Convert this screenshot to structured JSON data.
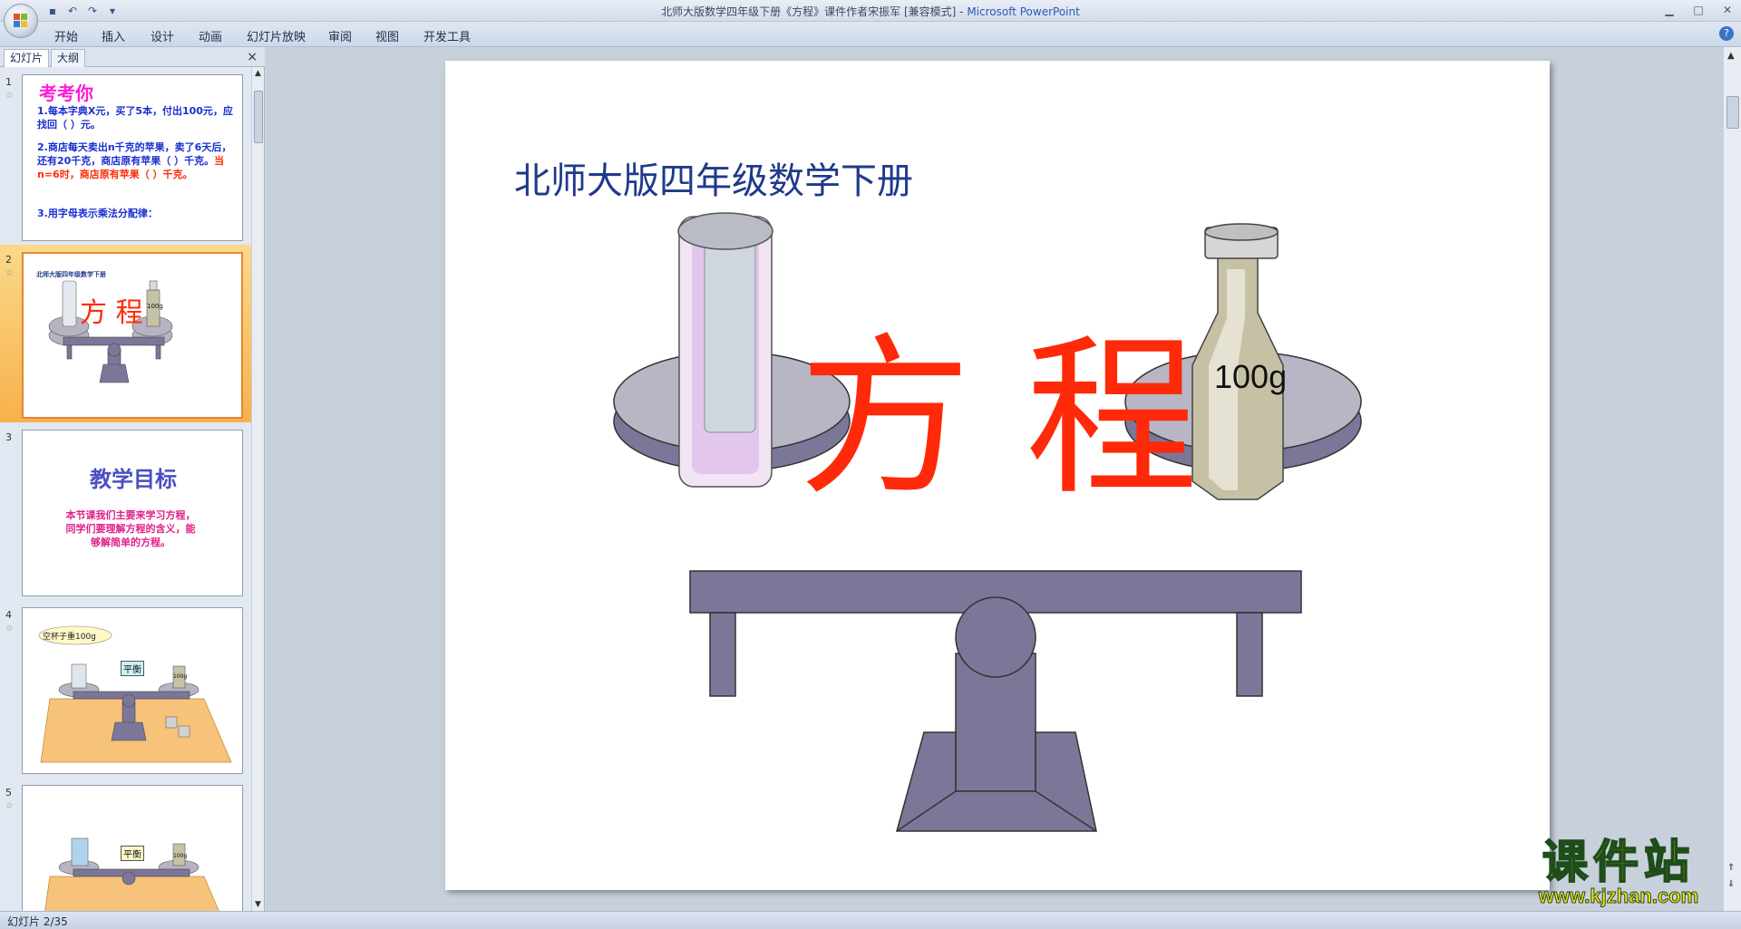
{
  "window": {
    "title": "北师大版数学四年级下册《方程》课件作者宋振军 [兼容模式]",
    "title_app": "Microsoft PowerPoint"
  },
  "ribbon": {
    "tabs": [
      "开始",
      "插入",
      "设计",
      "动画",
      "幻灯片放映",
      "审阅",
      "视图",
      "开发工具"
    ]
  },
  "pane": {
    "tabs": [
      "幻灯片",
      "大纲"
    ],
    "close_glyph": "×"
  },
  "thumbnails": [
    {
      "num": "1",
      "title": "考考你",
      "q1": "1.每本字典X元，买了5本，付出100元，应找回（    ）元。",
      "q2a": "2.商店每天卖出n千克的苹果，卖了6天后，还有20千克，商店原有苹果（    ）千克。",
      "q2b": "当n=6时，商店原有苹果（    ）千克。",
      "q3": "3.用字母表示乘法分配律："
    },
    {
      "num": "2",
      "title": "北师大版四年级数学下册",
      "word": "方 程",
      "weight": "100g"
    },
    {
      "num": "3",
      "title": "教学目标",
      "body": "本节课我们主要来学习方程，同学们要理解方程的含义，能够解简单的方程。"
    },
    {
      "num": "4",
      "bubble": "空杯子重100g",
      "badge": "平衡",
      "weight": "100g"
    },
    {
      "num": "5",
      "badge": "平衡",
      "weight": "100g"
    }
  ],
  "slide": {
    "title": "北师大版四年级数学下册",
    "big_word": "方程",
    "weight_label": "100g"
  },
  "watermark": {
    "cn": "课件站",
    "url": "www.kjzhan.com"
  },
  "status": {
    "slide_counter": "幻灯片 2/35"
  },
  "colors": {
    "scale_fill": "#7c7799",
    "title_blue": "#1f3a8a",
    "word_red": "#ff2a0a",
    "selected_thumb": "#f7b14c"
  }
}
